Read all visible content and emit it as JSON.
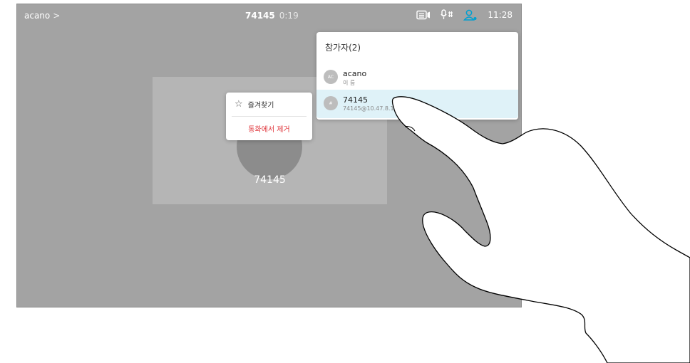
{
  "topbar": {
    "breadcrumb": "acano",
    "call_number": "74145",
    "call_timer": "0:19",
    "time": "11:28"
  },
  "tile": {
    "name": "74145"
  },
  "context_menu": {
    "favorite_label": "즐겨찾기",
    "remove_label": "통화에서 제거"
  },
  "participants": {
    "title": "참가자(2)",
    "items": [
      {
        "initials": "AC",
        "name": "acano",
        "detail": "이 름"
      },
      {
        "initials": "#",
        "name": "74145",
        "detail": "74145@10.47.8.1"
      }
    ]
  },
  "colors": {
    "accent": "#00a0d1",
    "danger": "#e0383e",
    "selected_row": "#dff2f8"
  }
}
